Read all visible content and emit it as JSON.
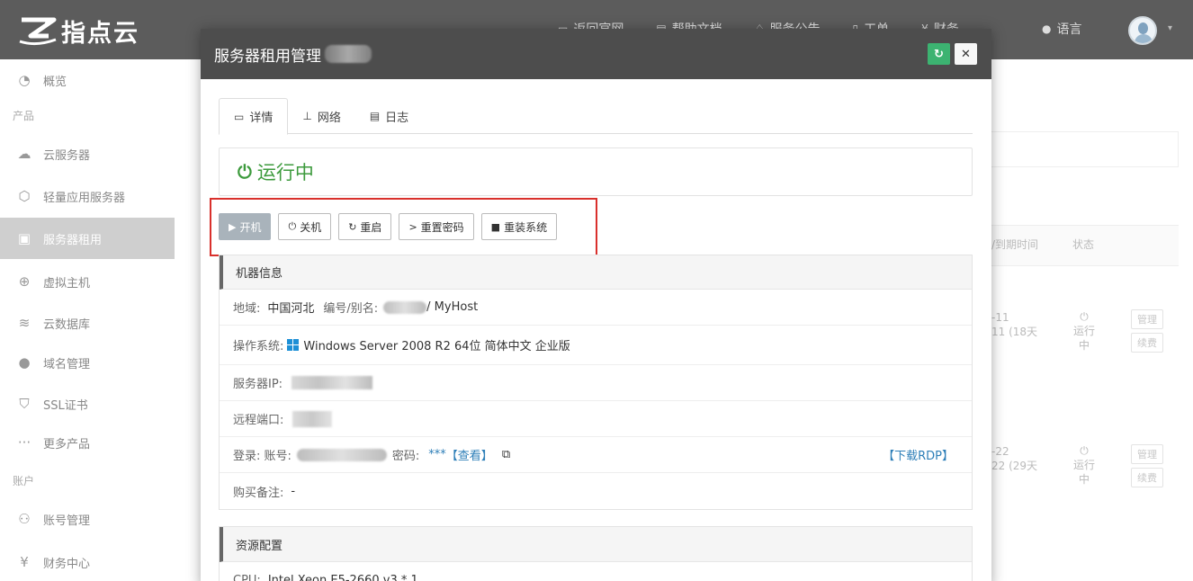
{
  "app": {
    "logo_text": "指点云",
    "topnav": [
      {
        "icon": "monitor-icon",
        "label": "返回官网"
      },
      {
        "icon": "book-icon",
        "label": "帮助文档"
      },
      {
        "icon": "bell-icon",
        "label": "服务公告"
      },
      {
        "icon": "file-icon",
        "label": "工单"
      },
      {
        "icon": "yen-icon",
        "label": "财务"
      }
    ],
    "language_label": "语言"
  },
  "sidebar": {
    "overview": "概览",
    "section_products": "产品",
    "items": [
      {
        "label": "云服务器",
        "icon": "cloud-server-icon"
      },
      {
        "label": "轻量应用服务器",
        "icon": "cube-icon"
      },
      {
        "label": "服务器租用",
        "icon": "server-icon"
      },
      {
        "label": "虚拟主机",
        "icon": "globe-host-icon"
      },
      {
        "label": "云数据库",
        "icon": "layers-icon"
      },
      {
        "label": "域名管理",
        "icon": "globe-icon"
      },
      {
        "label": "SSL证书",
        "icon": "shield-icon"
      },
      {
        "label": "更多产品",
        "icon": "more-icon"
      }
    ],
    "section_account": "账户",
    "account_items": [
      {
        "label": "账号管理",
        "icon": "user-icon"
      },
      {
        "label": "财务中心",
        "icon": "yen-circle-icon"
      }
    ]
  },
  "background_table": {
    "col_expire": "/到期时间",
    "col_status": "状态",
    "rows": [
      {
        "date_a": "-11",
        "date_b": "11 (18天",
        "status": "运行中",
        "manage": "管理",
        "renew": "续费"
      },
      {
        "date_a": "-22",
        "date_b": "22 (29天",
        "status": "运行中",
        "manage": "管理",
        "renew": "续费"
      }
    ]
  },
  "modal": {
    "title": "服务器租用管理",
    "tabs": [
      {
        "label": "详情",
        "icon": "monitor-icon"
      },
      {
        "label": "网络",
        "icon": "sitemap-icon"
      },
      {
        "label": "日志",
        "icon": "log-icon"
      }
    ],
    "status": "运行中",
    "actions": [
      {
        "label": "开机",
        "icon": "play-icon"
      },
      {
        "label": "关机",
        "icon": "power-icon"
      },
      {
        "label": "重启",
        "icon": "refresh-icon"
      },
      {
        "label": "重置密码",
        "icon": "terminal-icon"
      },
      {
        "label": "重装系统",
        "icon": "disk-icon"
      }
    ],
    "machine_info": {
      "title": "机器信息",
      "region_label": "地域:",
      "region_value": "中国河北",
      "id_label": "编号/别名:",
      "alias": "/ MyHost",
      "os_label": "操作系统:",
      "os_value": "Windows Server 2008 R2 64位 简体中文 企业版",
      "ip_label": "服务器IP:",
      "port_label": "远程端口:",
      "login_label": "登录: 账号:",
      "password_label": "密码:",
      "password_mask": "***",
      "view_link": "【查看】",
      "rdp_link": "【下载RDP】",
      "note_label": "购买备注:",
      "note_value": "-"
    },
    "resource": {
      "title": "资源配置",
      "cpu_label": "CPU:",
      "cpu_value": "Intel Xeon E5-2660 v3 * 1"
    }
  }
}
